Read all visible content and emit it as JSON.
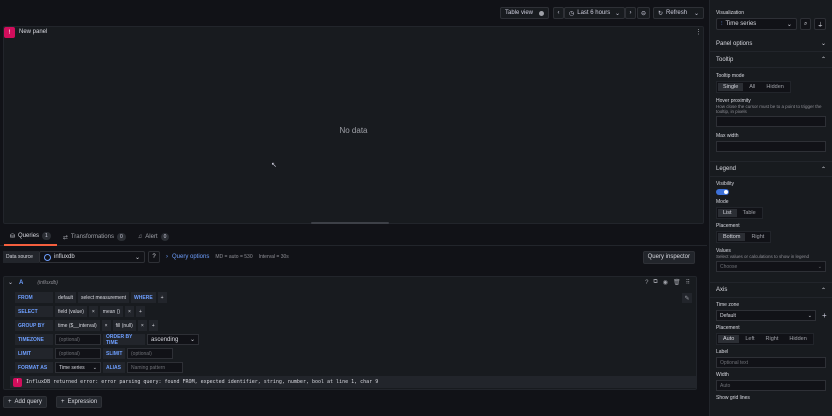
{
  "toolbar": {
    "table_view": "Table view",
    "time_range": "Last 6 hours",
    "refresh": "Refresh"
  },
  "panel": {
    "title": "New panel",
    "empty": "No data"
  },
  "tabs": [
    {
      "label": "Queries",
      "count": "1"
    },
    {
      "label": "Transformations",
      "count": "0"
    },
    {
      "label": "Alert",
      "count": "0"
    }
  ],
  "datasource": {
    "label": "Data source",
    "value": "influxdb",
    "query_options": "Query options",
    "md": "MD = auto = 530",
    "interval": "Interval = 30s",
    "inspector": "Query inspector"
  },
  "query": {
    "ref": "A",
    "ds": "(influxdb)",
    "from": {
      "label": "FROM",
      "policy": "default",
      "measurement": "select measurement",
      "where": "WHERE",
      "plus": "+"
    },
    "select": {
      "label": "SELECT",
      "field": "field",
      "value": "(value)",
      "agg": "mean",
      "paren": "()",
      "x": "×",
      "plus": "+"
    },
    "groupby": {
      "label": "GROUP BY",
      "time": "time",
      "interval": "($__interval)",
      "fill": "fill",
      "null": "(null)",
      "x": "×",
      "plus": "+"
    },
    "timezone": {
      "label": "TIMEZONE",
      "placeholder": "(optional)",
      "order_label": "ORDER BY TIME",
      "order": "ascending"
    },
    "limit": {
      "label": "LIMIT",
      "placeholder": "(optional)",
      "slimit_label": "SLIMIT",
      "slimit": "(optional)"
    },
    "format": {
      "label": "FORMAT AS",
      "value": "Time series",
      "alias_label": "ALIAS",
      "alias": "Naming pattern"
    },
    "error": "InfluxDB returned error: error parsing query: found FROM, expected identifier, string, number, bool at line 1, char 9"
  },
  "buttons": {
    "add_query": "Add query",
    "expression": "Expression"
  },
  "sidebar": {
    "viz_label": "Visualization",
    "viz_value": "Time series",
    "panel_options": "Panel options",
    "tooltip": {
      "title": "Tooltip",
      "mode_label": "Tooltip mode",
      "modes": [
        "Single",
        "All",
        "Hidden"
      ],
      "hover_label": "Hover proximity",
      "hover_desc": "How close the cursor must be to a point to trigger the tooltip, in pixels",
      "maxwidth_label": "Max width"
    },
    "legend": {
      "title": "Legend",
      "vis_label": "Visibility",
      "mode_label": "Mode",
      "modes": [
        "List",
        "Table"
      ],
      "placement_label": "Placement",
      "placements": [
        "Bottom",
        "Right"
      ],
      "values_label": "Values",
      "values_desc": "Select values or calculations to show in legend",
      "values_placeholder": "Choose"
    },
    "axis": {
      "title": "Axis",
      "tz_label": "Time zone",
      "tz_value": "Default",
      "placement_label": "Placement",
      "placements": [
        "Auto",
        "Left",
        "Right",
        "Hidden"
      ],
      "label_label": "Label",
      "label_placeholder": "Optional text",
      "width_label": "Width",
      "width_placeholder": "Auto",
      "grid_label": "Show grid lines"
    }
  },
  "colors": {
    "accent": "#6e9fff",
    "error": "#d10e5c",
    "toggle": "#3d71d9"
  }
}
